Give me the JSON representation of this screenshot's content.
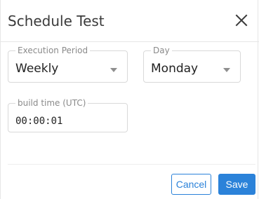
{
  "dialog": {
    "title": "Schedule Test",
    "close_icon": "close-icon"
  },
  "fields": {
    "execution_period": {
      "label": "Execution Period",
      "value": "Weekly"
    },
    "day": {
      "label": "Day",
      "value": "Monday"
    },
    "build_time": {
      "label": "build time (UTC)",
      "value": "00:00:01"
    }
  },
  "footer": {
    "cancel_label": "Cancel",
    "save_label": "Save"
  },
  "colors": {
    "accent": "#2b82d9",
    "border": "#d9d9d9",
    "label": "#8a8a8a"
  }
}
